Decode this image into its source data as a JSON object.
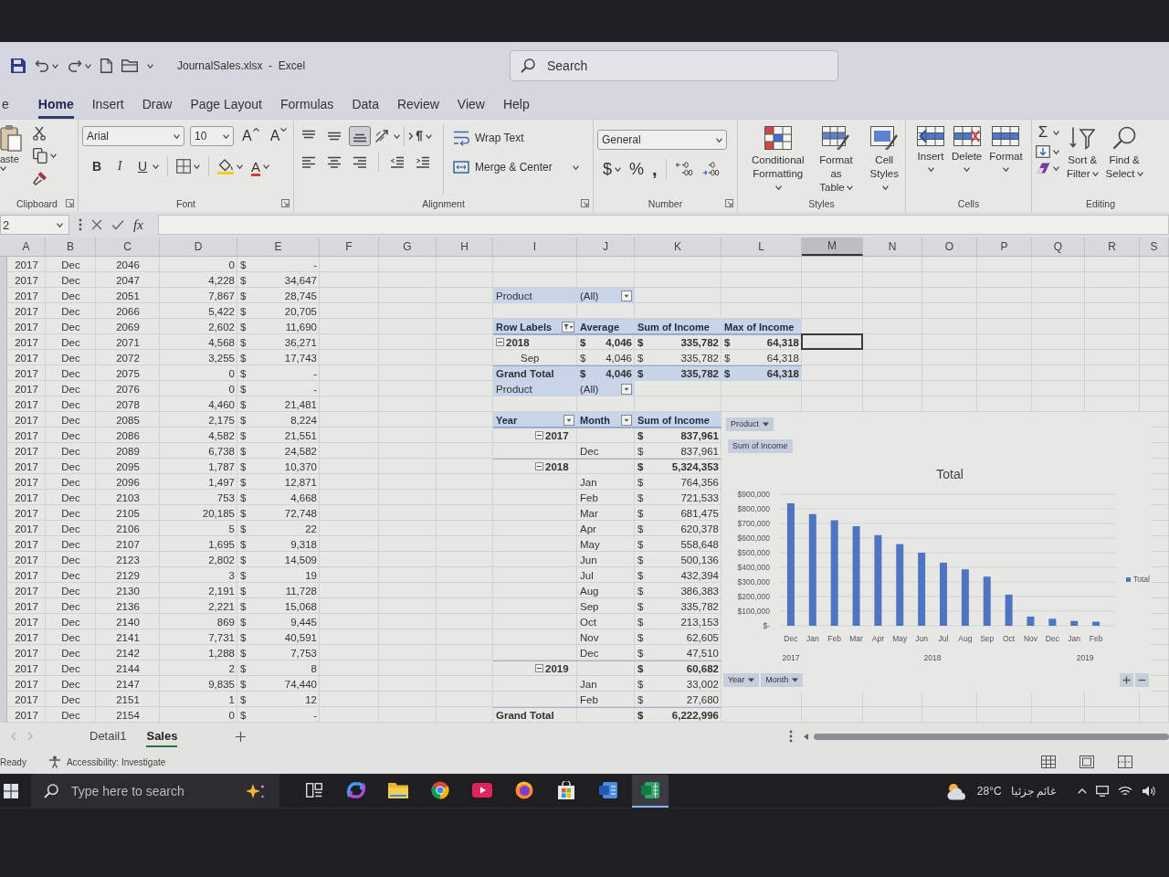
{
  "title_bar": {
    "title": "JournalSales.xlsx  -  Excel",
    "search": {
      "placeholder": "Search"
    }
  },
  "tabs": [
    {
      "label": "e",
      "selected": false
    },
    {
      "label": "Home",
      "selected": true
    },
    {
      "label": "Insert",
      "selected": false
    },
    {
      "label": "Draw",
      "selected": false
    },
    {
      "label": "Page Layout",
      "selected": false
    },
    {
      "label": "Formulas",
      "selected": false
    },
    {
      "label": "Data",
      "selected": false
    },
    {
      "label": "Review",
      "selected": false
    },
    {
      "label": "View",
      "selected": false
    },
    {
      "label": "Help",
      "selected": false
    }
  ],
  "ribbon": {
    "clipboard": {
      "title": "Clipboard",
      "paste": "aste"
    },
    "font": {
      "title": "Font",
      "font_name": "Arial",
      "font_size": "10",
      "grow": "A",
      "shrink": "A",
      "bold": "B",
      "italic": "I",
      "underline": "U",
      "font_color": "A"
    },
    "alignment": {
      "title": "Alignment",
      "vertical": [
        {
          "kind": "top",
          "selected": false
        },
        {
          "kind": "middle",
          "selected": false
        },
        {
          "kind": "bottom",
          "selected": true
        }
      ],
      "wrap_text": "Wrap Text",
      "merge": "Merge & Center"
    },
    "number": {
      "title": "Number",
      "format": "General",
      "currency": "$",
      "percent": "%",
      "comma": ","
    },
    "styles": {
      "title": "Styles",
      "buttons": [
        {
          "kind": "conditional",
          "lines": [
            "Conditional",
            "Formatting"
          ]
        },
        {
          "kind": "table",
          "lines": [
            "Format as",
            "Table"
          ]
        },
        {
          "kind": "cell",
          "lines": [
            "Cell",
            "Styles"
          ]
        }
      ]
    },
    "cells": {
      "title": "Cells",
      "buttons": [
        {
          "kind": "insert",
          "label": "Insert"
        },
        {
          "kind": "delete",
          "label": "Delete"
        },
        {
          "kind": "format",
          "label": "Format"
        }
      ]
    },
    "editing": {
      "title": "Editing",
      "autosum": "Σ",
      "buttons": [
        {
          "kind": "sort",
          "lines": [
            "Sort &",
            "Filter"
          ]
        },
        {
          "kind": "find",
          "lines": [
            "Find &",
            "Select"
          ]
        }
      ]
    }
  },
  "formula_bar": {
    "name_box": "2",
    "function_label": "fx"
  },
  "columns": [
    {
      "label": "A",
      "selected": false
    },
    {
      "label": "B",
      "selected": false
    },
    {
      "label": "C",
      "selected": false
    },
    {
      "label": "D",
      "selected": false
    },
    {
      "label": "E",
      "selected": false
    },
    {
      "label": "F",
      "selected": false
    },
    {
      "label": "G",
      "selected": false
    },
    {
      "label": "H",
      "selected": false
    },
    {
      "label": "I",
      "selected": false
    },
    {
      "label": "J",
      "selected": false
    },
    {
      "label": "K",
      "selected": false
    },
    {
      "label": "L",
      "selected": false
    },
    {
      "label": "M",
      "selected": true
    },
    {
      "label": "N",
      "selected": false
    },
    {
      "label": "O",
      "selected": false
    },
    {
      "label": "P",
      "selected": false
    },
    {
      "label": "Q",
      "selected": false
    },
    {
      "label": "R",
      "selected": false
    },
    {
      "label": "S",
      "selected": false
    }
  ],
  "data_rows": [
    {
      "cells": [
        "2017",
        "Dec",
        "2046",
        "0",
        "$",
        "-"
      ],
      "selected": false
    },
    {
      "cells": [
        "2017",
        "Dec",
        "2047",
        "4,228",
        "$",
        "34,647"
      ],
      "selected": false
    },
    {
      "cells": [
        "2017",
        "Dec",
        "2051",
        "7,867",
        "$",
        "28,745"
      ],
      "selected": false
    },
    {
      "cells": [
        "2017",
        "Dec",
        "2066",
        "5,422",
        "$",
        "20,705"
      ],
      "selected": false
    },
    {
      "cells": [
        "2017",
        "Dec",
        "2069",
        "2,602",
        "$",
        "11,690"
      ],
      "selected": false
    },
    {
      "cells": [
        "2017",
        "Dec",
        "2071",
        "4,568",
        "$",
        "36,271"
      ],
      "selected": true
    },
    {
      "cells": [
        "2017",
        "Dec",
        "2072",
        "3,255",
        "$",
        "17,743"
      ],
      "selected": false
    },
    {
      "cells": [
        "2017",
        "Dec",
        "2075",
        "0",
        "$",
        "-"
      ],
      "selected": false
    },
    {
      "cells": [
        "2017",
        "Dec",
        "2076",
        "0",
        "$",
        "-"
      ],
      "selected": false
    },
    {
      "cells": [
        "2017",
        "Dec",
        "2078",
        "4,460",
        "$",
        "21,481"
      ],
      "selected": false
    },
    {
      "cells": [
        "2017",
        "Dec",
        "2085",
        "2,175",
        "$",
        "8,224"
      ],
      "selected": false
    },
    {
      "cells": [
        "2017",
        "Dec",
        "2086",
        "4,582",
        "$",
        "21,551"
      ],
      "selected": false
    },
    {
      "cells": [
        "2017",
        "Dec",
        "2089",
        "6,738",
        "$",
        "24,582"
      ],
      "selected": false
    },
    {
      "cells": [
        "2017",
        "Dec",
        "2095",
        "1,787",
        "$",
        "10,370"
      ],
      "selected": false
    },
    {
      "cells": [
        "2017",
        "Dec",
        "2096",
        "1,497",
        "$",
        "12,871"
      ],
      "selected": false
    },
    {
      "cells": [
        "2017",
        "Dec",
        "2103",
        "753",
        "$",
        "4,668"
      ],
      "selected": false
    },
    {
      "cells": [
        "2017",
        "Dec",
        "2105",
        "20,185",
        "$",
        "72,748"
      ],
      "selected": false
    },
    {
      "cells": [
        "2017",
        "Dec",
        "2106",
        "5",
        "$",
        "22"
      ],
      "selected": false
    },
    {
      "cells": [
        "2017",
        "Dec",
        "2107",
        "1,695",
        "$",
        "9,318"
      ],
      "selected": false
    },
    {
      "cells": [
        "2017",
        "Dec",
        "2123",
        "2,802",
        "$",
        "14,509"
      ],
      "selected": false
    },
    {
      "cells": [
        "2017",
        "Dec",
        "2129",
        "3",
        "$",
        "19"
      ],
      "selected": false
    },
    {
      "cells": [
        "2017",
        "Dec",
        "2130",
        "2,191",
        "$",
        "11,728"
      ],
      "selected": false
    },
    {
      "cells": [
        "2017",
        "Dec",
        "2136",
        "2,221",
        "$",
        "15,068"
      ],
      "selected": false
    },
    {
      "cells": [
        "2017",
        "Dec",
        "2140",
        "869",
        "$",
        "9,445"
      ],
      "selected": false
    },
    {
      "cells": [
        "2017",
        "Dec",
        "2141",
        "7,731",
        "$",
        "40,591"
      ],
      "selected": false
    },
    {
      "cells": [
        "2017",
        "Dec",
        "2142",
        "1,288",
        "$",
        "7,753"
      ],
      "selected": false
    },
    {
      "cells": [
        "2017",
        "Dec",
        "2144",
        "2",
        "$",
        "8"
      ],
      "selected": false
    },
    {
      "cells": [
        "2017",
        "Dec",
        "2147",
        "9,835",
        "$",
        "74,440"
      ],
      "selected": false
    },
    {
      "cells": [
        "2017",
        "Dec",
        "2151",
        "1",
        "$",
        "12"
      ],
      "selected": false
    },
    {
      "cells": [
        "2017",
        "Dec",
        "2154",
        "0",
        "$",
        "-"
      ],
      "selected": false
    }
  ],
  "pivot_1": {
    "kind": "compact",
    "filter": {
      "label": "Product",
      "value": "(All)"
    },
    "headers": [
      {
        "label": "Row Labels",
        "dropdown": true,
        "filtered": true
      },
      {
        "label": "Average",
        "dropdown": false,
        "filtered": false
      },
      {
        "label": "Sum of Income",
        "dropdown": false,
        "filtered": false
      },
      {
        "label": "Max of Income",
        "dropdown": false,
        "filtered": false
      }
    ],
    "rows": [
      {
        "kind": "year",
        "label": "2018",
        "expanded": true,
        "values": [
          {
            "symbol": "$",
            "amount": "4,046"
          },
          {
            "symbol": "$",
            "amount": "335,782"
          },
          {
            "symbol": "$",
            "amount": "64,318"
          }
        ]
      },
      {
        "kind": "month",
        "label": "Sep",
        "values": [
          {
            "symbol": "$",
            "amount": "4,046"
          },
          {
            "symbol": "$",
            "amount": "335,782"
          },
          {
            "symbol": "$",
            "amount": "64,318"
          }
        ]
      },
      {
        "kind": "total",
        "label": "Grand Total",
        "values": [
          {
            "symbol": "$",
            "amount": "4,046"
          },
          {
            "symbol": "$",
            "amount": "335,782"
          },
          {
            "symbol": "$",
            "amount": "64,318"
          }
        ]
      }
    ]
  },
  "pivot_2": {
    "kind": "tabular",
    "filter": {
      "label": "Product",
      "value": "(All)"
    },
    "headers": [
      {
        "label": "Year",
        "dropdown": true,
        "filtered": false
      },
      {
        "label": "Month",
        "dropdown": true,
        "filtered": false
      },
      {
        "label": "Sum of Income",
        "dropdown": false,
        "filtered": false
      }
    ],
    "rows": [
      {
        "kind": "year",
        "label": "2017",
        "expanded": true,
        "values": [
          {
            "symbol": "$",
            "amount": "837,961"
          }
        ]
      },
      {
        "kind": "month",
        "label": "Dec",
        "values": [
          {
            "symbol": "$",
            "amount": "837,961"
          }
        ]
      },
      {
        "kind": "year",
        "label": "2018",
        "expanded": true,
        "values": [
          {
            "symbol": "$",
            "amount": "5,324,353"
          }
        ]
      },
      {
        "kind": "month",
        "label": "Jan",
        "values": [
          {
            "symbol": "$",
            "amount": "764,356"
          }
        ]
      },
      {
        "kind": "month",
        "label": "Feb",
        "values": [
          {
            "symbol": "$",
            "amount": "721,533"
          }
        ]
      },
      {
        "kind": "month",
        "label": "Mar",
        "values": [
          {
            "symbol": "$",
            "amount": "681,475"
          }
        ]
      },
      {
        "kind": "month",
        "label": "Apr",
        "values": [
          {
            "symbol": "$",
            "amount": "620,378"
          }
        ]
      },
      {
        "kind": "month",
        "label": "May",
        "values": [
          {
            "symbol": "$",
            "amount": "558,648"
          }
        ]
      },
      {
        "kind": "month",
        "label": "Jun",
        "values": [
          {
            "symbol": "$",
            "amount": "500,136"
          }
        ]
      },
      {
        "kind": "month",
        "label": "Jul",
        "values": [
          {
            "symbol": "$",
            "amount": "432,394"
          }
        ]
      },
      {
        "kind": "month",
        "label": "Aug",
        "values": [
          {
            "symbol": "$",
            "amount": "386,383"
          }
        ]
      },
      {
        "kind": "month",
        "label": "Sep",
        "values": [
          {
            "symbol": "$",
            "amount": "335,782"
          }
        ]
      },
      {
        "kind": "month",
        "label": "Oct",
        "values": [
          {
            "symbol": "$",
            "amount": "213,153"
          }
        ]
      },
      {
        "kind": "month",
        "label": "Nov",
        "values": [
          {
            "symbol": "$",
            "amount": "62,605"
          }
        ]
      },
      {
        "kind": "month",
        "label": "Dec",
        "values": [
          {
            "symbol": "$",
            "amount": "47,510"
          }
        ]
      },
      {
        "kind": "year",
        "label": "2019",
        "expanded": true,
        "values": [
          {
            "symbol": "$",
            "amount": "60,682"
          }
        ]
      },
      {
        "kind": "month",
        "label": "Jan",
        "values": [
          {
            "symbol": "$",
            "amount": "33,002"
          }
        ]
      },
      {
        "kind": "month",
        "label": "Feb",
        "values": [
          {
            "symbol": "$",
            "amount": "27,680"
          }
        ]
      },
      {
        "kind": "total",
        "label": "Grand Total",
        "values": [
          {
            "symbol": "$",
            "amount": "6,222,996"
          }
        ]
      }
    ]
  },
  "pivot_chart": {
    "field_buttons": {
      "filter": "Product",
      "values": "Sum of Income",
      "axis": [
        "Year",
        "Month"
      ]
    },
    "axis_groups": [
      "2017",
      "2018",
      "2019"
    ],
    "chart_data": {
      "type": "bar",
      "title": "Total",
      "categories": [
        "Dec",
        "Jan",
        "Feb",
        "Mar",
        "Apr",
        "May",
        "Jun",
        "Jul",
        "Aug",
        "Sep",
        "Oct",
        "Nov",
        "Dec",
        "Jan",
        "Feb"
      ],
      "series": [
        {
          "name": "Total",
          "color": "#4f74c2",
          "values": [
            838000,
            764000,
            722000,
            681000,
            620000,
            559000,
            500000,
            432000,
            386000,
            336000,
            213000,
            63000,
            48000,
            33000,
            28000
          ]
        }
      ],
      "ylim": [
        0,
        900000
      ],
      "yticks": [
        {
          "value": 0,
          "label": "$-"
        },
        {
          "value": 100000,
          "label": "$100,000"
        },
        {
          "value": 200000,
          "label": "$200,000"
        },
        {
          "value": 300000,
          "label": "$300,000"
        },
        {
          "value": 400000,
          "label": "$400,000"
        },
        {
          "value": 500000,
          "label": "$500,000"
        },
        {
          "value": 600000,
          "label": "$600,000"
        },
        {
          "value": 700000,
          "label": "$700,000"
        },
        {
          "value": 800000,
          "label": "$800,000"
        },
        {
          "value": 900000,
          "label": "$900,000"
        }
      ],
      "grid": true
    }
  },
  "sheet_tabs": [
    {
      "label": "Detail1",
      "selected": false
    },
    {
      "label": "Sales",
      "selected": true
    }
  ],
  "status_bar": {
    "status": "Ready",
    "accessibility": "Accessibility: Investigate",
    "views": [
      {
        "kind": "normal"
      },
      {
        "kind": "page_layout"
      },
      {
        "kind": "page_break"
      }
    ]
  },
  "taskbar": {
    "search": {
      "placeholder": "Type here to search"
    },
    "apps": [
      {
        "kind": "task_view",
        "selected": false
      },
      {
        "kind": "swirl",
        "selected": false
      },
      {
        "kind": "folder",
        "selected": false
      },
      {
        "kind": "ring",
        "selected": false
      },
      {
        "kind": "play",
        "selected": false
      },
      {
        "kind": "globe",
        "selected": false
      },
      {
        "kind": "bag",
        "selected": false
      },
      {
        "kind": "document",
        "selected": false
      },
      {
        "kind": "spreadsheet",
        "selected": true
      }
    ],
    "weather": {
      "temperature": "28°C",
      "condition": "غائم جزئيا"
    }
  }
}
